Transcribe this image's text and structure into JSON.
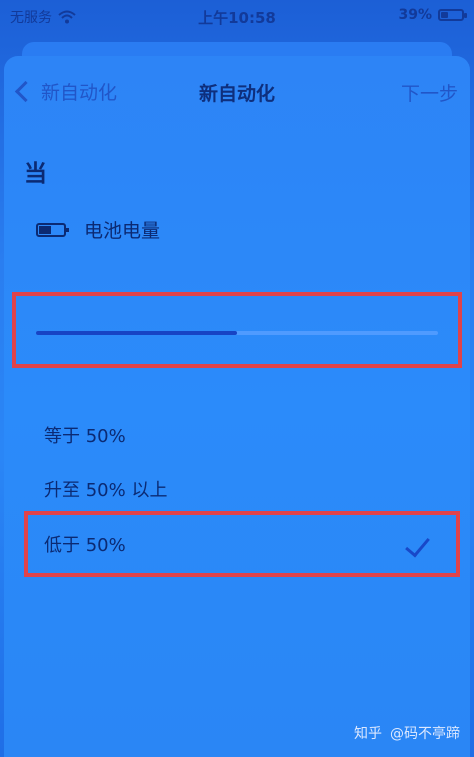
{
  "status_bar": {
    "carrier": "无服务",
    "time": "上午10:58",
    "battery": "39%",
    "battery_level": 0.39
  },
  "nav": {
    "back_label": "新自动化",
    "title": "新自动化",
    "next_label": "下一步"
  },
  "section": {
    "label": "当"
  },
  "trigger": {
    "label": "电池电量"
  },
  "slider": {
    "value_percent": 50
  },
  "options": [
    {
      "label": "等于 50%",
      "selected": false
    },
    {
      "label": "升至 50% 以上",
      "selected": false
    },
    {
      "label": "低于 50%",
      "selected": true
    }
  ],
  "watermark": {
    "site": "知乎",
    "author": "@码不亭蹄"
  },
  "colors": {
    "background": "#1e62d8",
    "highlight_box": "#e0434a",
    "accent": "#2156c8"
  }
}
